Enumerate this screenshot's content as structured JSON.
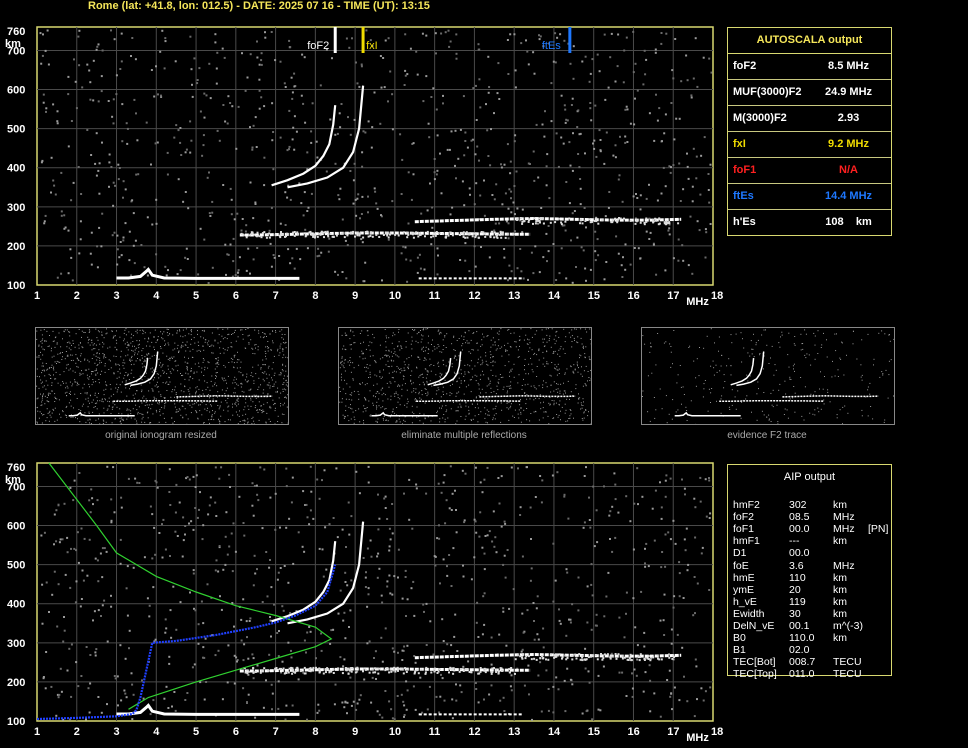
{
  "header": "Rome (lat: +41.8, lon: 012.5) - DATE: 2025 07 16 - TIME (UT): 13:15",
  "axis": {
    "y_unit": "km",
    "x_unit": "MHz",
    "y_ticks": [
      "760",
      "700",
      "600",
      "500",
      "400",
      "300",
      "200",
      "100"
    ],
    "x_ticks": [
      "1",
      "2",
      "3",
      "4",
      "5",
      "6",
      "7",
      "8",
      "9",
      "10",
      "11",
      "12",
      "13",
      "14",
      "15",
      "16",
      "17",
      "18"
    ]
  },
  "markers": [
    {
      "label": "foF2",
      "freq": 8.5,
      "color": "#ffffff"
    },
    {
      "label": "fxI",
      "freq": 9.2,
      "color": "#f0dc00"
    },
    {
      "label": "ftEs",
      "freq": 14.4,
      "color": "#1e78ff"
    }
  ],
  "autoscala": {
    "title": "AUTOSCALA output",
    "rows": [
      {
        "label": "foF2",
        "value": "8.5 MHz",
        "color": "#ffffff"
      },
      {
        "label": "MUF(3000)F2",
        "value": "24.9 MHz",
        "color": "#ffffff"
      },
      {
        "label": "M(3000)F2",
        "value": "2.93",
        "color": "#ffffff"
      },
      {
        "label": "fxI",
        "value": "9.2 MHz",
        "color": "#f0dc00"
      },
      {
        "label": "foF1",
        "value": "N/A",
        "color": "#ff2020"
      },
      {
        "label": "ftEs",
        "value": "14.4 MHz",
        "color": "#1e78ff"
      },
      {
        "label": "h'Es",
        "value": "108    km",
        "color": "#ffffff"
      }
    ]
  },
  "thumbnails": [
    {
      "caption": "original ionogram resized"
    },
    {
      "caption": "eliminate multiple reflections"
    },
    {
      "caption": "evidence F2 trace"
    }
  ],
  "aip": {
    "title": "AIP output",
    "rows": [
      {
        "param": "hmF2",
        "value": "302",
        "unit": "km",
        "flag": ""
      },
      {
        "param": "foF2",
        "value": "08.5",
        "unit": "MHz",
        "flag": ""
      },
      {
        "param": "foF1",
        "value": "00.0",
        "unit": "MHz",
        "flag": "[PN]"
      },
      {
        "param": "hmF1",
        "value": "---",
        "unit": "km",
        "flag": ""
      },
      {
        "param": "D1",
        "value": "00.0",
        "unit": "",
        "flag": ""
      },
      {
        "param": "foE",
        "value": "3.6",
        "unit": "MHz",
        "flag": ""
      },
      {
        "param": "hmE",
        "value": "110",
        "unit": "km",
        "flag": ""
      },
      {
        "param": "ymE",
        "value": "20",
        "unit": "km",
        "flag": ""
      },
      {
        "param": "h_vE",
        "value": "119",
        "unit": "km",
        "flag": ""
      },
      {
        "param": "Ewidth",
        "value": "30",
        "unit": "km",
        "flag": ""
      },
      {
        "param": "DelN_vE",
        "value": "00.1",
        "unit": "m^(-3)",
        "flag": ""
      },
      {
        "param": "B0",
        "value": "110.0",
        "unit": "km",
        "flag": ""
      },
      {
        "param": "B1",
        "value": "02.0",
        "unit": "",
        "flag": ""
      },
      {
        "param": "TEC[Bot]",
        "value": "008.7",
        "unit": "TECU",
        "flag": ""
      },
      {
        "param": "TEC[Top]",
        "value": "011.0",
        "unit": "TECU",
        "flag": ""
      }
    ]
  },
  "chart_data": {
    "type": "scatter",
    "xlim": [
      1,
      18
    ],
    "ylim": [
      100,
      760
    ],
    "traces": {
      "E_trace": {
        "x": [
          3.0,
          3.3,
          3.6,
          3.75,
          3.8,
          3.9,
          4.2,
          5.0,
          6.0,
          7.0,
          7.6
        ],
        "y": [
          118,
          118,
          122,
          135,
          140,
          125,
          118,
          117,
          117,
          117,
          117
        ]
      },
      "F_trace_low": {
        "x": [
          6.1,
          6.5,
          7.0,
          7.5,
          8.0,
          8.5,
          9.0,
          10.0,
          11.0,
          12.0,
          13.0,
          13.4
        ],
        "y": [
          228,
          228,
          229,
          230,
          231,
          232,
          233,
          233,
          232,
          231,
          230,
          230
        ]
      },
      "F_trace_high": {
        "x": [
          10.5,
          11.5,
          12.5,
          13.5,
          14.5,
          15.5,
          16.5,
          17.2
        ],
        "y": [
          262,
          265,
          268,
          270,
          268,
          266,
          266,
          268
        ]
      },
      "ordinary_F2": {
        "x": [
          6.9,
          7.3,
          7.7,
          8.0,
          8.2,
          8.35,
          8.45,
          8.5
        ],
        "y": [
          355,
          368,
          385,
          405,
          430,
          460,
          510,
          560
        ]
      },
      "extraordinary_F2": {
        "x": [
          7.3,
          7.8,
          8.3,
          8.7,
          8.95,
          9.1,
          9.2
        ],
        "y": [
          350,
          360,
          375,
          400,
          440,
          500,
          610
        ]
      },
      "Es_trace": {
        "x": [
          10.6,
          11.0,
          11.5,
          12.0,
          12.5,
          13.2
        ],
        "y": [
          117,
          117,
          117,
          117,
          117,
          117
        ]
      },
      "profile_blue": {
        "x": [
          1.0,
          2.0,
          3.0,
          3.4,
          3.5,
          3.6,
          3.9,
          4.5,
          5.5,
          6.5,
          7.0,
          7.5,
          8.0,
          8.3,
          8.5
        ],
        "y": [
          105,
          108,
          112,
          118,
          128,
          160,
          300,
          305,
          320,
          340,
          352,
          370,
          395,
          430,
          500
        ]
      },
      "profile_green": {
        "x": [
          3.3,
          3.8,
          5.0,
          6.0,
          7.0,
          8.0,
          8.4,
          8.0,
          7.0,
          6.0,
          5.0,
          4.0,
          3.0,
          2.5,
          1.3
        ],
        "y": [
          130,
          160,
          200,
          230,
          260,
          290,
          310,
          340,
          370,
          395,
          430,
          470,
          530,
          600,
          760
        ]
      }
    }
  }
}
